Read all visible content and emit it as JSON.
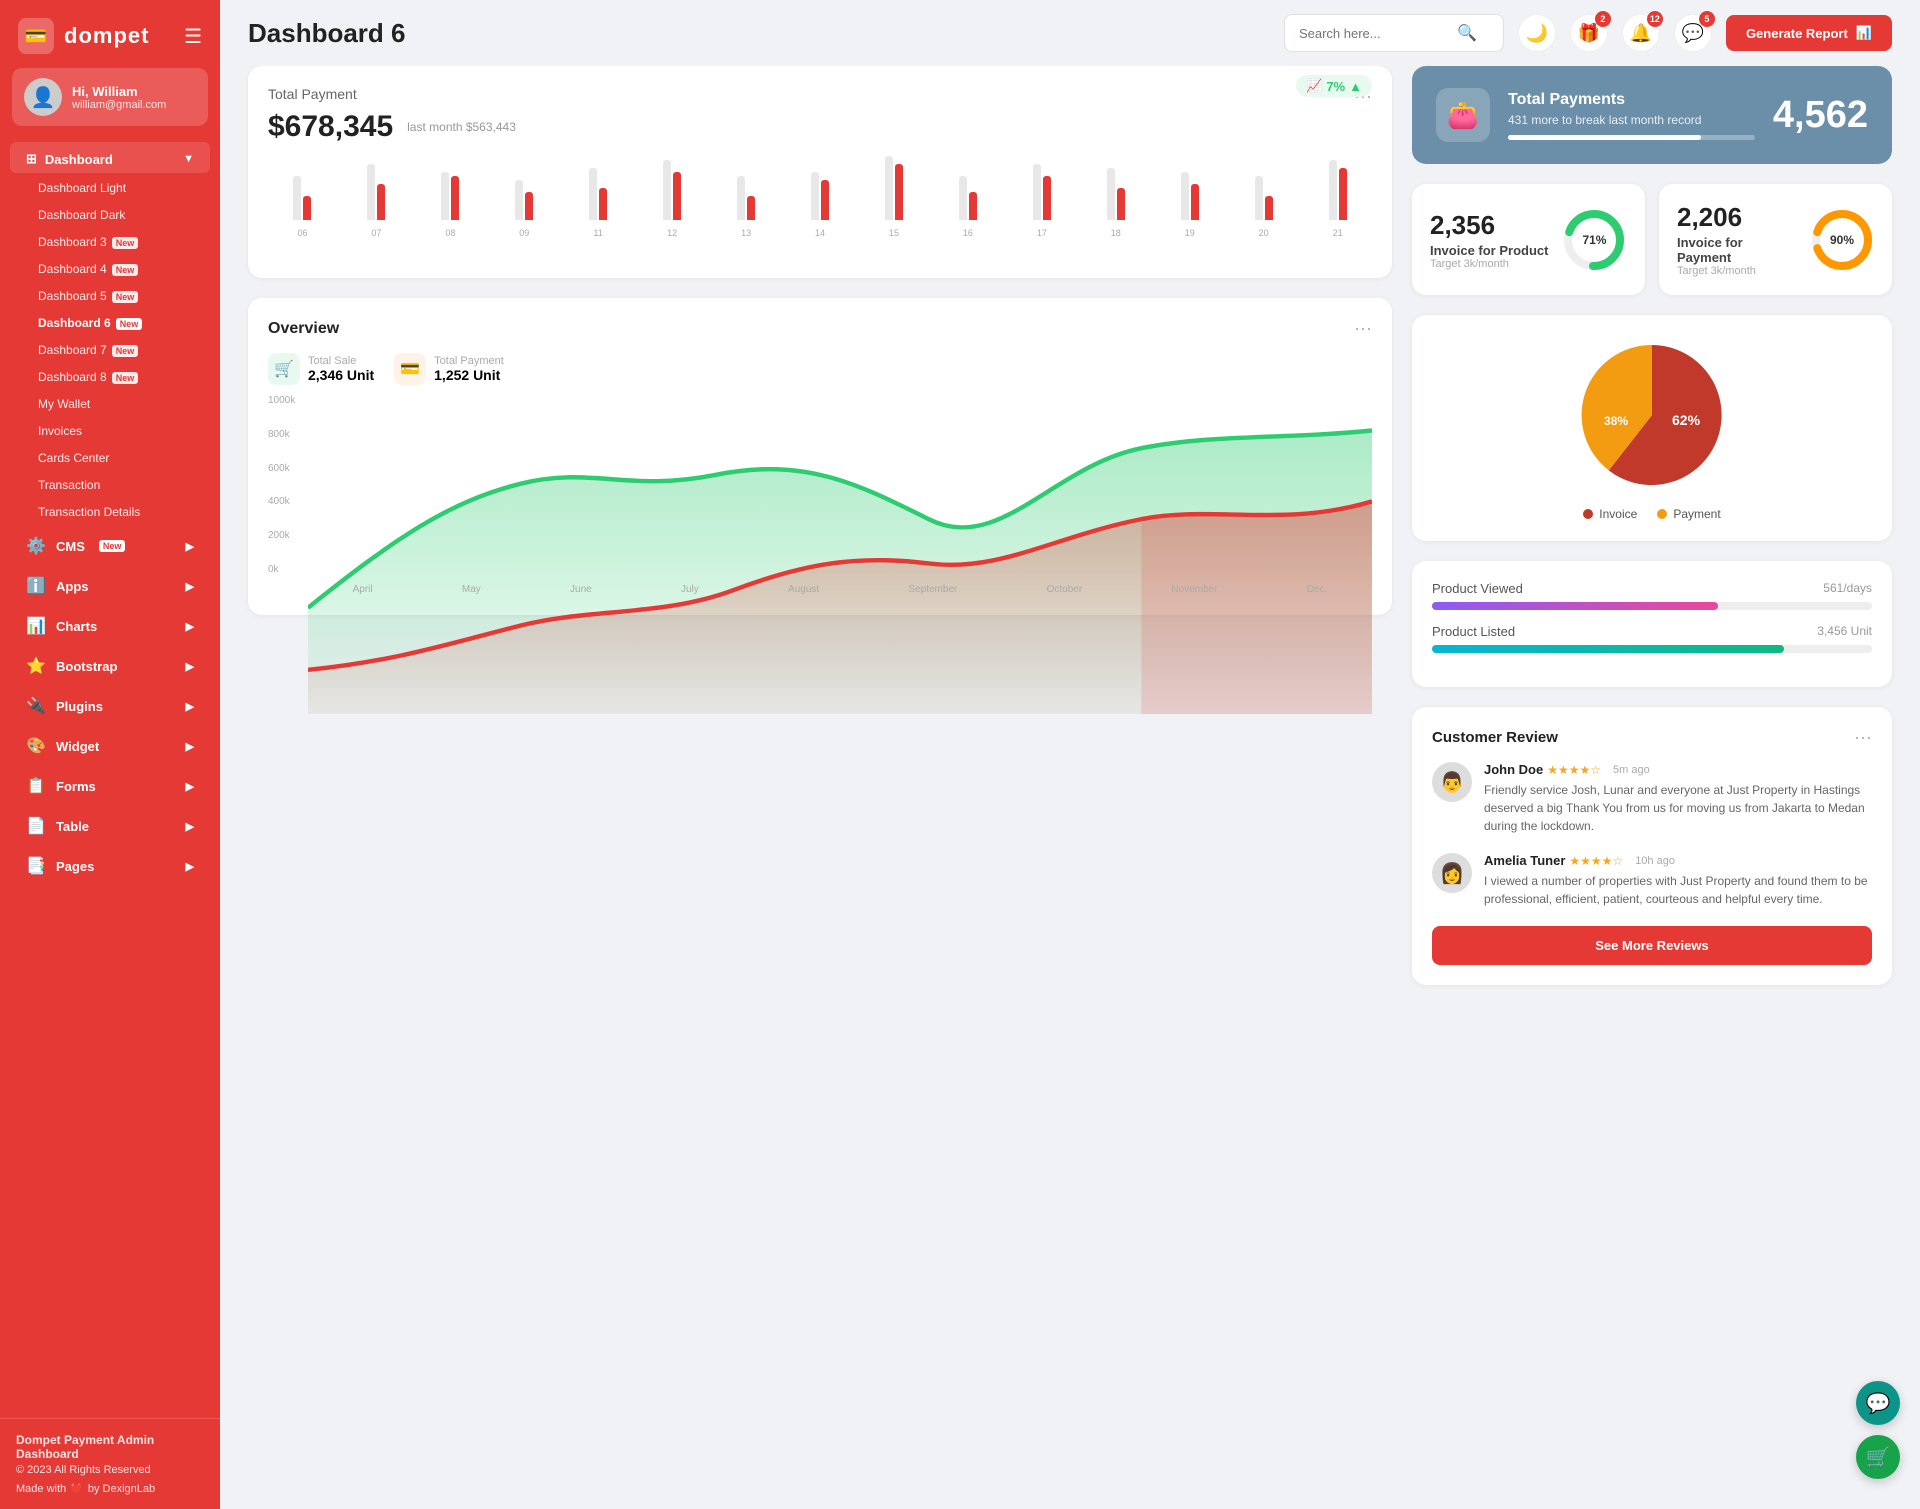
{
  "sidebar": {
    "logo": "dompet",
    "logo_icon": "💳",
    "hamburger": "☰",
    "user": {
      "name": "Hi, William",
      "email": "william@gmail.com",
      "avatar": "👤"
    },
    "nav": {
      "dashboard_label": "Dashboard",
      "dashboard_arrow": "▼",
      "items": [
        {
          "label": "Dashboard Light",
          "active": false,
          "badge": ""
        },
        {
          "label": "Dashboard Dark",
          "active": false,
          "badge": ""
        },
        {
          "label": "Dashboard 3",
          "active": false,
          "badge": "New"
        },
        {
          "label": "Dashboard 4",
          "active": false,
          "badge": "New"
        },
        {
          "label": "Dashboard 5",
          "active": false,
          "badge": "New"
        },
        {
          "label": "Dashboard 6",
          "active": true,
          "badge": "New"
        },
        {
          "label": "Dashboard 7",
          "active": false,
          "badge": "New"
        },
        {
          "label": "Dashboard 8",
          "active": false,
          "badge": "New"
        },
        {
          "label": "My Wallet",
          "active": false,
          "badge": ""
        },
        {
          "label": "Invoices",
          "active": false,
          "badge": ""
        },
        {
          "label": "Cards Center",
          "active": false,
          "badge": ""
        },
        {
          "label": "Transaction",
          "active": false,
          "badge": ""
        },
        {
          "label": "Transaction Details",
          "active": false,
          "badge": ""
        }
      ],
      "menu_items": [
        {
          "label": "CMS",
          "icon": "⚙️",
          "badge": "New",
          "arrow": "▶"
        },
        {
          "label": "Apps",
          "icon": "ℹ️",
          "badge": "",
          "arrow": "▶"
        },
        {
          "label": "Charts",
          "icon": "📊",
          "badge": "",
          "arrow": "▶"
        },
        {
          "label": "Bootstrap",
          "icon": "⭐",
          "badge": "",
          "arrow": "▶"
        },
        {
          "label": "Plugins",
          "icon": "🔌",
          "badge": "",
          "arrow": "▶"
        },
        {
          "label": "Widget",
          "icon": "🎨",
          "badge": "",
          "arrow": "▶"
        },
        {
          "label": "Forms",
          "icon": "📋",
          "badge": "",
          "arrow": "▶"
        },
        {
          "label": "Table",
          "icon": "📄",
          "badge": "",
          "arrow": "▶"
        },
        {
          "label": "Pages",
          "icon": "📑",
          "badge": "",
          "arrow": "▶"
        }
      ]
    },
    "footer": {
      "title": "Dompet Payment Admin Dashboard",
      "copyright": "© 2023 All Rights Reserved",
      "made": "Made with",
      "heart": "❤️",
      "by": "by DexignLab"
    }
  },
  "topbar": {
    "title": "Dashboard 6",
    "search_placeholder": "Search here...",
    "icons": {
      "moon": "🌙",
      "gift_badge": 2,
      "bell_badge": 12,
      "chat_badge": 5
    },
    "generate_btn": "Generate Report"
  },
  "total_payment": {
    "label": "Total Payment",
    "amount": "$678,345",
    "last_month": "last month $563,443",
    "trend": "7%",
    "bars": [
      {
        "gray": 55,
        "red": 30,
        "label": "06"
      },
      {
        "gray": 70,
        "red": 45,
        "label": "07"
      },
      {
        "gray": 60,
        "red": 55,
        "label": "08"
      },
      {
        "gray": 50,
        "red": 35,
        "label": "09"
      },
      {
        "gray": 65,
        "red": 40,
        "label": "11"
      },
      {
        "gray": 75,
        "red": 60,
        "label": "12"
      },
      {
        "gray": 55,
        "red": 30,
        "label": "13"
      },
      {
        "gray": 60,
        "red": 50,
        "label": "14"
      },
      {
        "gray": 80,
        "red": 70,
        "label": "15"
      },
      {
        "gray": 55,
        "red": 35,
        "label": "16"
      },
      {
        "gray": 70,
        "red": 55,
        "label": "17"
      },
      {
        "gray": 65,
        "red": 40,
        "label": "18"
      },
      {
        "gray": 60,
        "red": 45,
        "label": "19"
      },
      {
        "gray": 55,
        "red": 30,
        "label": "20"
      },
      {
        "gray": 75,
        "red": 65,
        "label": "21"
      }
    ]
  },
  "total_payments_blue": {
    "icon": "👛",
    "title": "Total Payments",
    "sub": "431 more to break last month record",
    "number": "4,562",
    "progress": 78
  },
  "invoice_product": {
    "number": "2,356",
    "label": "Invoice for Product",
    "target": "Target 3k/month",
    "percent": 71,
    "color": "#2ecc71"
  },
  "invoice_payment": {
    "number": "2,206",
    "label": "Invoice for Payment",
    "target": "Target 3k/month",
    "percent": 90,
    "color": "#ff9800"
  },
  "overview": {
    "title": "Overview",
    "total_sale_label": "Total Sale",
    "total_sale_value": "2,346 Unit",
    "total_payment_label": "Total Payment",
    "total_payment_value": "1,252 Unit",
    "y_labels": [
      "1000k",
      "800k",
      "600k",
      "400k",
      "200k",
      "0k"
    ],
    "x_labels": [
      "April",
      "May",
      "June",
      "July",
      "August",
      "September",
      "October",
      "November",
      "Dec."
    ]
  },
  "pie_chart": {
    "invoice_pct": 62,
    "payment_pct": 38,
    "legend": [
      {
        "label": "Invoice",
        "color": "#c0392b"
      },
      {
        "label": "Payment",
        "color": "#f39c12"
      }
    ]
  },
  "product_stats": [
    {
      "label": "Product Viewed",
      "value": "561/days",
      "width": "65%",
      "type": "purple"
    },
    {
      "label": "Product Listed",
      "value": "3,456 Unit",
      "width": "80%",
      "type": "teal"
    }
  ],
  "customer_review": {
    "title": "Customer Review",
    "reviews": [
      {
        "name": "John Doe",
        "stars": 4,
        "time": "5m ago",
        "text": "Friendly service Josh, Lunar and everyone at Just Property in Hastings deserved a big Thank You from us for moving us from Jakarta to Medan during the lockdown.",
        "avatar": "👨"
      },
      {
        "name": "Amelia Tuner",
        "stars": 4,
        "time": "10h ago",
        "text": "I viewed a number of properties with Just Property and found them to be professional, efficient, patient, courteous and helpful every time.",
        "avatar": "👩"
      }
    ],
    "see_more_btn": "See More Reviews"
  },
  "float_btns": {
    "chat_icon": "💬",
    "cart_icon": "🛒"
  }
}
